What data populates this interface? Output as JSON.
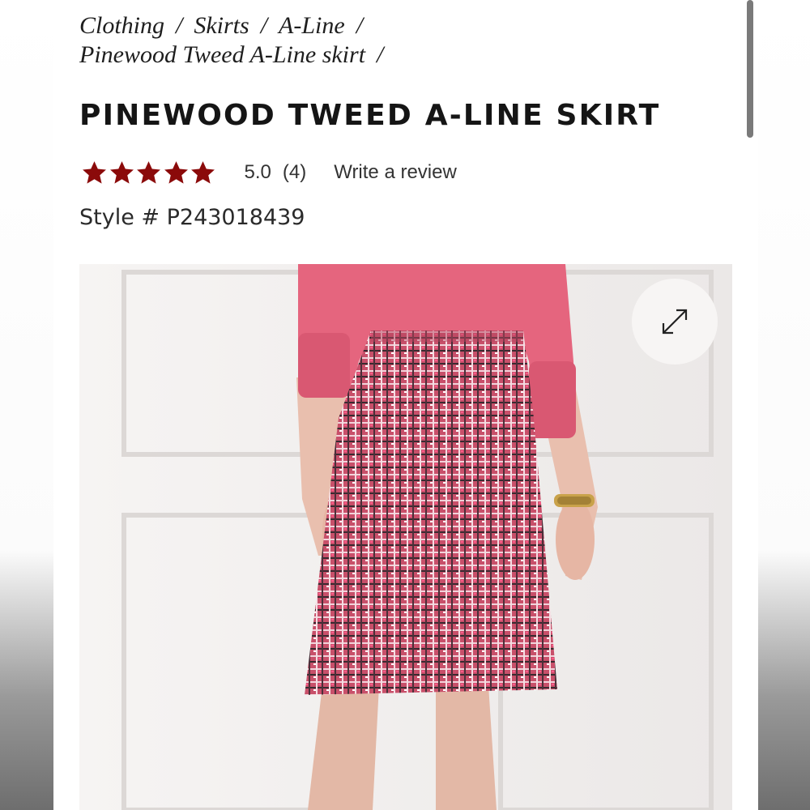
{
  "breadcrumb": {
    "items": [
      "Clothing",
      "Skirts",
      "A-Line",
      "Pinewood Tweed A-Line skirt"
    ],
    "separator": "/"
  },
  "product": {
    "title": "PINEWOOD TWEED A-LINE SKIRT",
    "rating": {
      "stars": 5,
      "max_stars": 5,
      "value": "5.0",
      "count": "(4)",
      "star_color": "#8b0a0a"
    },
    "write_review": "Write a review",
    "style_number": "Style # P243018439"
  },
  "image": {
    "expand_icon": "expand-arrows-icon",
    "sweater_color": "#e5657e",
    "skirt_color": "#c9566f"
  }
}
